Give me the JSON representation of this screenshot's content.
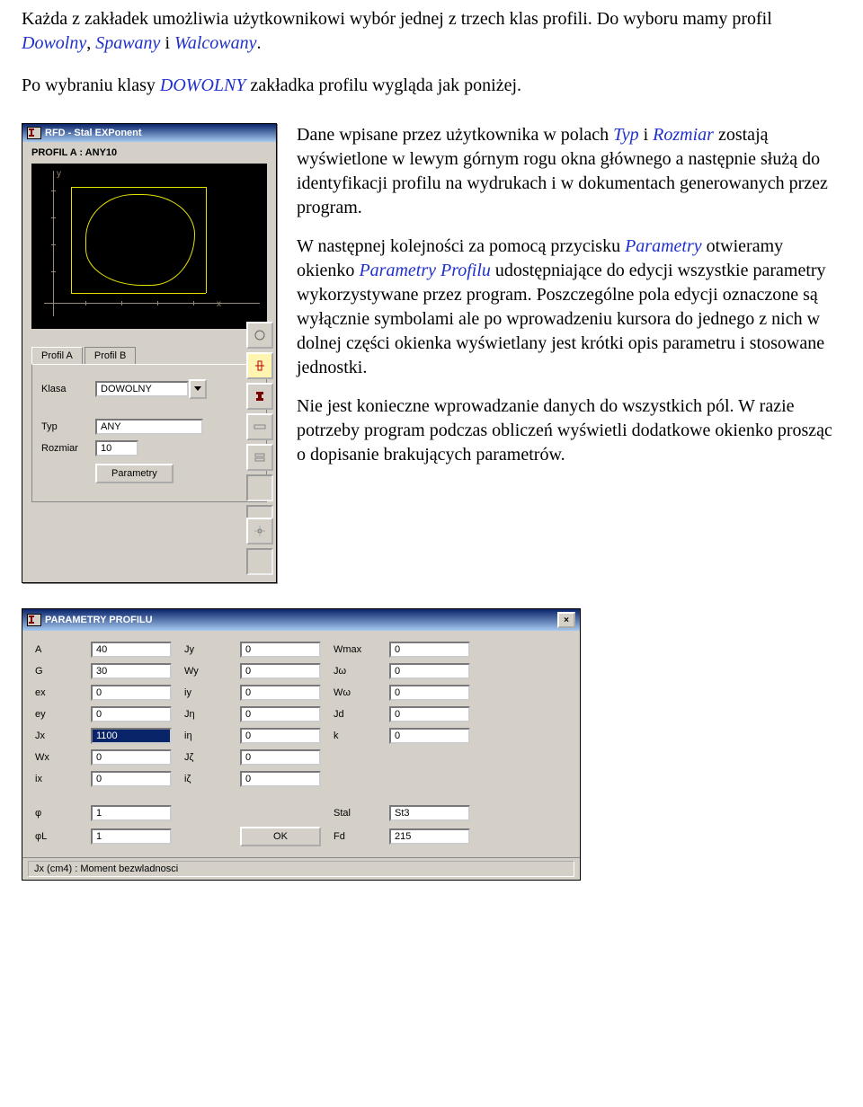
{
  "intro": {
    "p1a": "Każda z zakładek umożliwia użytkownikowi wybór jednej z trzech klas profili. Do wyboru mamy profil ",
    "em1": "Dowolny",
    "p1b": ", ",
    "em2": "Spawany",
    "p1c": " i ",
    "em3": "Walcowany",
    "p1d": ".",
    "p2a": "Po wybraniu klasy ",
    "em4": "DOWOLNY",
    "p2b": " zakładka profilu wygląda jak poniżej."
  },
  "dlg": {
    "title": "RFD - Stal EXPonent",
    "heading": "PROFIL  A  :  ANY10",
    "preview": {
      "xlabel": "x",
      "ylabel": "y"
    },
    "tabs": {
      "a": "Profil A",
      "b": "Profil B"
    },
    "klasa_label": "Klasa",
    "klasa_value": "DOWOLNY",
    "typ_label": "Typ",
    "typ_value": "ANY",
    "rozmiar_label": "Rozmiar",
    "rozmiar_value": "10",
    "param_btn": "Parametry"
  },
  "body": {
    "p1a": "Dane wpisane przez użytkownika w polach ",
    "em1": "Typ",
    "p1b": " i ",
    "em2": "Rozmiar",
    "p1c": " zostają wyświetlone w lewym górnym rogu okna głównego a następnie służą do identyfikacji profilu na wydrukach i w dokumentach generowanych przez program.",
    "p2a": "W następnej kolejności za pomocą przycisku ",
    "em3": "Parametry",
    "p2b": " otwieramy okienko ",
    "em4": "Parametry Profilu",
    "p2c": " udostępniające do edycji wszystkie parametry wykorzystywane przez program. Poszczególne pola edycji oznaczone są wyłącznie symbolami ale po wprowadzeniu kursora do jednego z nich w dolnej części okienka wyświetlany jest krótki opis parametru i stosowane jednostki.",
    "p3": "Nie jest konieczne wprowadzanie danych do wszystkich pól. W razie potrzeby program podczas obliczeń wyświetli dodatkowe okienko prosząc o dopisanie brakujących parametrów."
  },
  "paramdlg": {
    "title": "PARAMETRY PROFILU",
    "close": "×",
    "rows": [
      {
        "l1": "A",
        "v1": "40",
        "l2": "Jy",
        "v2": "0",
        "l3": "Wmax",
        "v3": "0"
      },
      {
        "l1": "G",
        "v1": "30",
        "l2": "Wy",
        "v2": "0",
        "l3": "Jω",
        "v3": "0"
      },
      {
        "l1": "ex",
        "v1": "0",
        "l2": "iy",
        "v2": "0",
        "l3": "Wω",
        "v3": "0"
      },
      {
        "l1": "ey",
        "v1": "0",
        "l2": "Jη",
        "v2": "0",
        "l3": "Jd",
        "v3": "0"
      },
      {
        "l1": "Jx",
        "v1": "1100",
        "l2": "iη",
        "v2": "0",
        "l3": "k",
        "v3": "0"
      },
      {
        "l1": "Wx",
        "v1": "0",
        "l2": "Jζ",
        "v2": "0"
      },
      {
        "l1": "ix",
        "v1": "0",
        "l2": "iζ",
        "v2": "0"
      }
    ],
    "rows2": [
      {
        "l1": "φ",
        "v1": "1",
        "l2": "",
        "v2": "",
        "l3": "Stal",
        "v3": "St3"
      },
      {
        "l1": "φL",
        "v1": "1",
        "l2": "OK",
        "v2": "",
        "l3": "Fd",
        "v3": "215"
      }
    ],
    "ok": "OK",
    "status": "Jx (cm4) : Moment bezwladnosci"
  }
}
